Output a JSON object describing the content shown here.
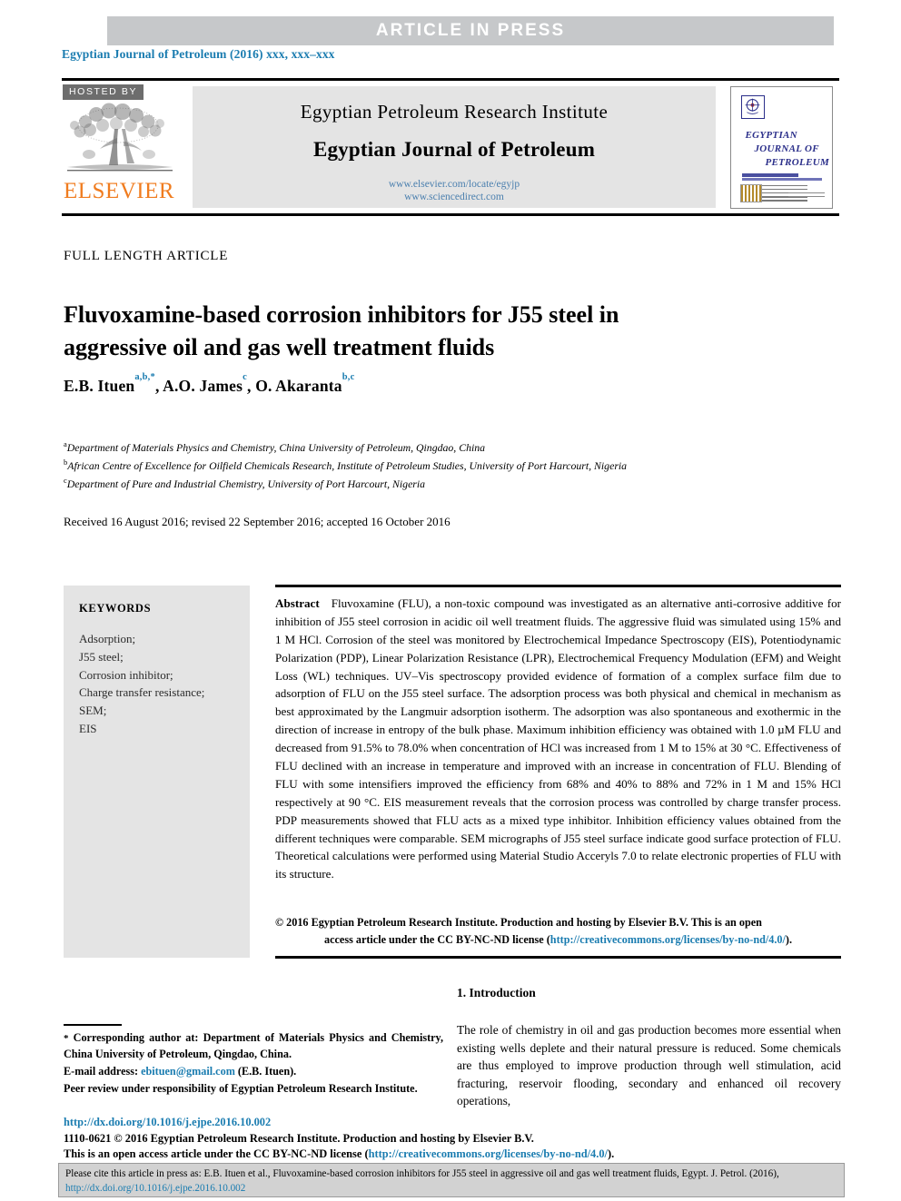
{
  "banner": {
    "label": "ARTICLE  IN  PRESS"
  },
  "journal_ref": "Egyptian Journal of Petroleum (2016) xxx, xxx–xxx",
  "masthead": {
    "hosted_by": "HOSTED BY",
    "publisher": "ELSEVIER",
    "institute": "Egyptian Petroleum Research Institute",
    "journal": "Egyptian Journal of Petroleum",
    "link_locate": "www.elsevier.com/locate/egyjp",
    "link_sciencedirect": "www.sciencedirect.com",
    "cover": {
      "line1": "EGYPTIAN",
      "line2": "JOURNAL OF",
      "line3": "PETROLEUM"
    }
  },
  "article": {
    "type": "FULL LENGTH ARTICLE",
    "title": "Fluvoxamine-based corrosion inhibitors for J55 steel in aggressive oil and gas well treatment fluids",
    "authors_plain": "E.B. Ituen a,b,*, A.O. James c, O. Akaranta b,c",
    "affiliations": [
      {
        "marker": "a",
        "text": "Department of Materials Physics and Chemistry, China University of Petroleum, Qingdao, China"
      },
      {
        "marker": "b",
        "text": "African Centre of Excellence for Oilfield Chemicals Research, Institute of Petroleum Studies, University of Port Harcourt, Nigeria"
      },
      {
        "marker": "c",
        "text": "Department of Pure and Industrial Chemistry, University of Port Harcourt, Nigeria"
      }
    ],
    "history": "Received 16 August 2016; revised 22 September 2016; accepted 16 October 2016"
  },
  "keywords": {
    "title": "KEYWORDS",
    "items": [
      "Adsorption;",
      "J55 steel;",
      "Corrosion inhibitor;",
      "Charge transfer resistance;",
      "SEM;",
      "EIS"
    ]
  },
  "abstract": {
    "label": "Abstract",
    "text": "Fluvoxamine (FLU), a non-toxic compound was investigated as an alternative anti-corrosive additive for inhibition of J55 steel corrosion in acidic oil well treatment fluids. The aggressive fluid was simulated using 15% and 1 M HCl. Corrosion of the steel was monitored by Electrochemical Impedance Spectroscopy (EIS), Potentiodynamic Polarization (PDP), Linear Polarization Resistance (LPR), Electrochemical Frequency Modulation (EFM) and Weight Loss (WL) techniques. UV–Vis spectroscopy provided evidence of formation of a complex surface film due to adsorption of FLU on the J55 steel surface. The adsorption process was both physical and chemical in mechanism as best approximated by the Langmuir adsorption isotherm. The adsorption was also spontaneous and exothermic in the direction of increase in entropy of the bulk phase. Maximum inhibition efficiency was obtained with 1.0 µM FLU and decreased from 91.5% to 78.0% when concentration of HCl was increased from 1 M to 15% at 30 °C. Effectiveness of FLU declined with an increase in temperature and improved with an increase in concentration of FLU. Blending of FLU with some intensifiers improved the efficiency from 68% and 40% to 88% and 72% in 1 M and 15% HCl respectively at 90 °C. EIS measurement reveals that the corrosion process was controlled by charge transfer process. PDP measurements showed that FLU acts as a mixed type inhibitor. Inhibition efficiency values obtained from the different techniques were comparable. SEM micrographs of J55 steel surface indicate good surface protection of FLU. Theoretical calculations were performed using Material Studio Acceryls 7.0 to relate electronic properties of FLU with its structure.",
    "copyright_line1": "© 2016 Egyptian Petroleum Research Institute. Production and hosting by Elsevier B.V. This is an open",
    "copyright_line2_pre": "access article under the CC BY-NC-ND license (",
    "copyright_link": "http://creativecommons.org/licenses/by-no-nd/4.0/",
    "copyright_line2_post": ")."
  },
  "introduction": {
    "heading": "1. Introduction",
    "body": "The role of chemistry in oil and gas production becomes more essential when existing wells deplete and their natural pressure is reduced. Some chemicals are thus employed to improve production through well stimulation, acid fracturing, reservoir flooding, secondary and enhanced oil recovery operations,"
  },
  "footnotes": {
    "corresponding": "Corresponding author at: Department of Materials Physics and Chemistry, China University of Petroleum, Qingdao, China.",
    "email_label": "E-mail address:",
    "email": "ebituen@gmail.com",
    "email_suffix": "(E.B. Ituen).",
    "peer_review": "Peer review under responsibility of Egyptian Petroleum Research Institute."
  },
  "publisher_block": {
    "doi": "http://dx.doi.org/10.1016/j.ejpe.2016.10.002",
    "issn_line": "1110-0621 © 2016 Egyptian Petroleum Research Institute. Production and hosting by Elsevier B.V.",
    "license_pre": "This is an open access article under the CC BY-NC-ND license (",
    "license_link": "http://creativecommons.org/licenses/by-no-nd/4.0/",
    "license_post": ")."
  },
  "cite_box": {
    "text_pre": "Please cite this article in press as: E.B. Ituen et al., Fluvoxamine-based corrosion inhibitors for J55 steel in aggressive oil and gas well treatment fluids, Egypt. J. Petrol. (2016), ",
    "link": "http://dx.doi.org/10.1016/j.ejpe.2016.10.002"
  },
  "colors": {
    "accent_link": "#1a7cb0",
    "banner_bg": "#c6c8ca",
    "panel_bg": "#e4e4e4",
    "elsevier_orange": "#f07c1f",
    "cite_bg": "#d2d2d2"
  }
}
